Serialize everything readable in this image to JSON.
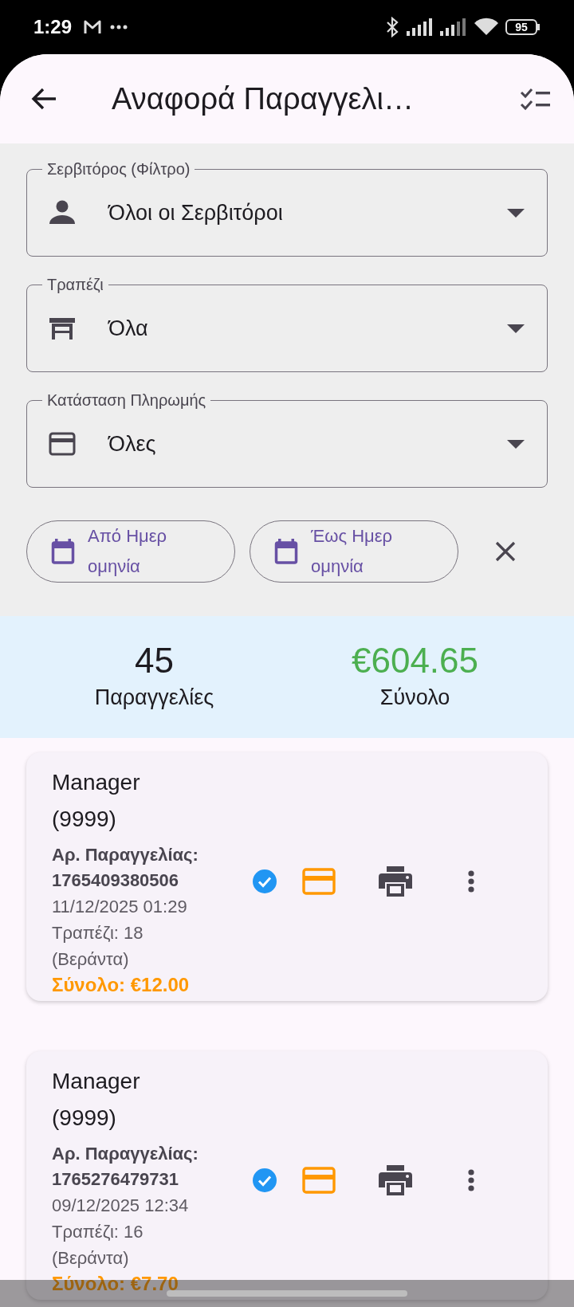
{
  "status_bar": {
    "time": "1:29",
    "battery": "95"
  },
  "app_bar": {
    "title": "Αναφορά Παραγγελι…"
  },
  "filters": [
    {
      "label": "Σερβιτόρος (Φίλτρο)",
      "value": "Όλοι οι Σερβιτόροι"
    },
    {
      "label": "Τραπέζι",
      "value": "Όλα"
    },
    {
      "label": "Κατάσταση Πληρωμής",
      "value": "Όλες"
    }
  ],
  "date_chips": [
    {
      "label": "Από Ημερομηνία"
    },
    {
      "label": "Έως Ημερομηνία"
    }
  ],
  "summary": {
    "count": "45",
    "count_label": "Παραγγελίες",
    "total": "€604.65",
    "total_label": "Σύνολο"
  },
  "orders": [
    {
      "waiter": "Manager (9999)",
      "order_no": "Αρ. Παραγγελίας: 1765409380506",
      "date": "11/12/2025 01:29",
      "table": "Τραπέζι: 18 (Βεράντα)",
      "total": "Σύνολο: €12.00",
      "paid": true
    },
    {
      "waiter": "Manager (9999)",
      "order_no": "Αρ. Παραγγελίας: 1765276479731",
      "date": "09/12/2025 12:34",
      "table": "Τραπέζι: 16 (Βεράντα)",
      "total": "Σύνολο: €7.70",
      "paid": true
    }
  ]
}
